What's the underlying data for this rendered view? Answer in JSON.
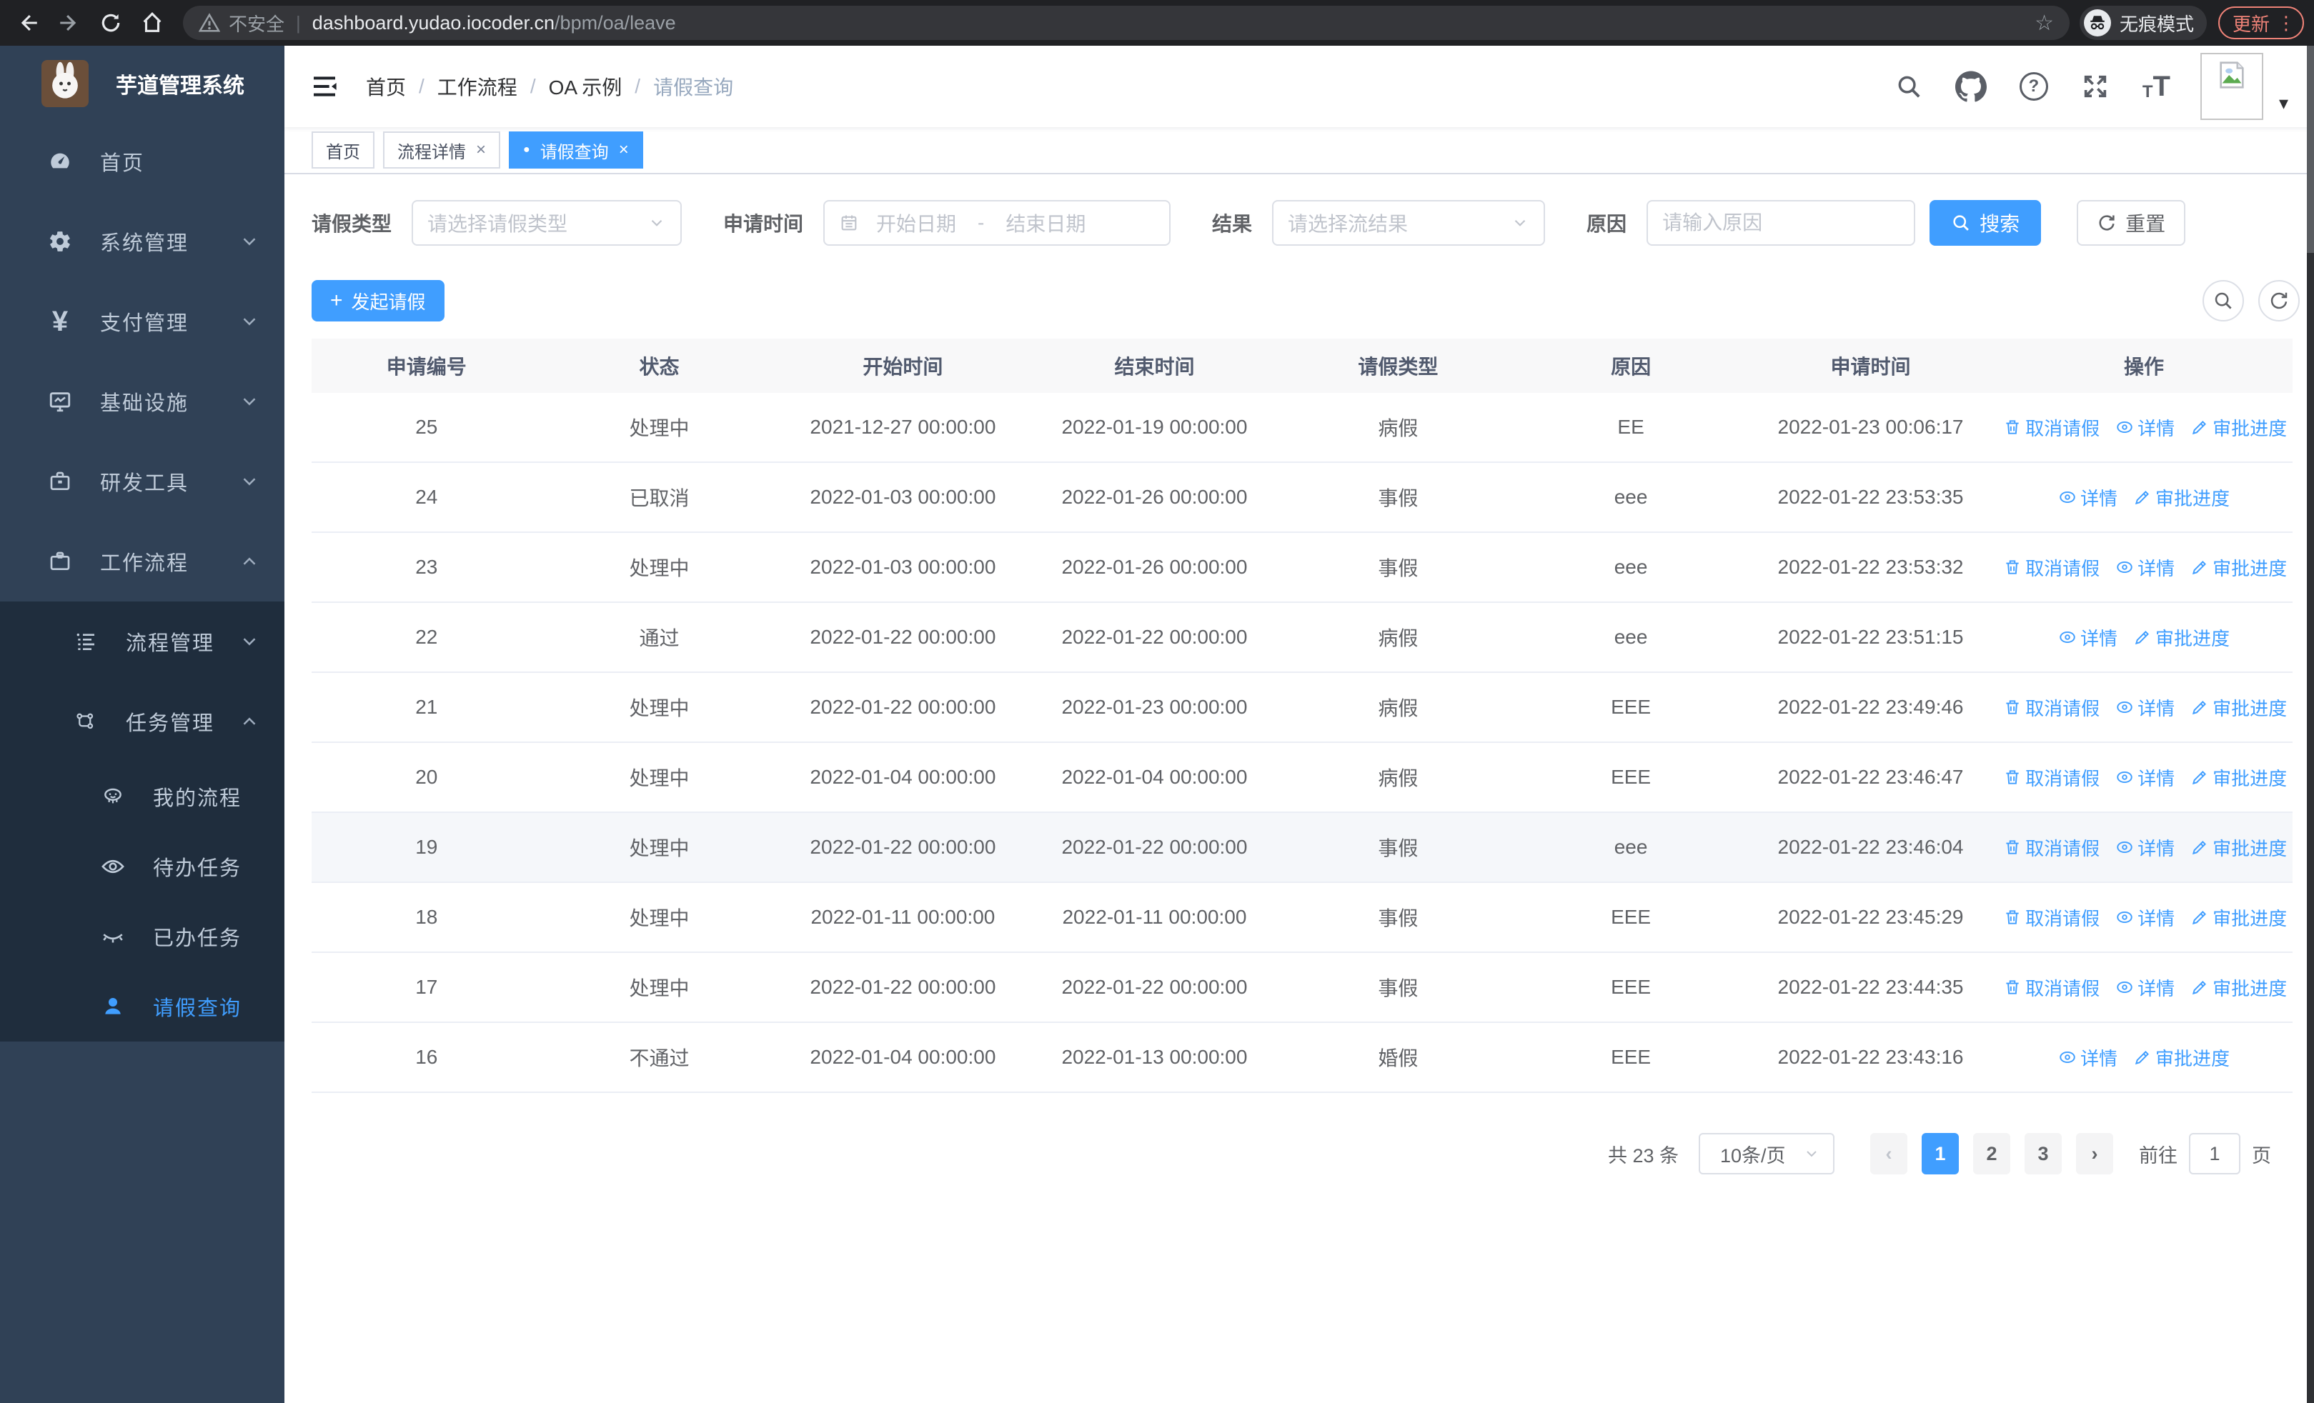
{
  "browser": {
    "security_label": "不安全",
    "url_host": "dashboard.yudao.iocoder.cn",
    "url_path": "/bpm/oa/leave",
    "incognito_label": "无痕模式",
    "update_label": "更新"
  },
  "icons": {
    "star": "☆",
    "menu_dots": "⋮",
    "caret_down": "▾",
    "close": "×",
    "dot": "●",
    "plus": "+",
    "question": "?",
    "url_separator": "|",
    "breadcrumb_separator": "/",
    "range_separator": "-",
    "prev": "‹",
    "next": "›",
    "font_small": "T",
    "font_big": "T"
  },
  "sidebar": {
    "logo_title": "芋道管理系统",
    "items": [
      {
        "label": "首页"
      },
      {
        "label": "系统管理"
      },
      {
        "label": "支付管理"
      },
      {
        "label": "基础设施"
      },
      {
        "label": "研发工具"
      },
      {
        "label": "工作流程"
      }
    ],
    "workflow_children": [
      {
        "label": "流程管理"
      },
      {
        "label": "任务管理"
      }
    ],
    "task_children": [
      {
        "label": "我的流程"
      },
      {
        "label": "待办任务"
      },
      {
        "label": "已办任务"
      },
      {
        "label": "请假查询"
      }
    ]
  },
  "header": {
    "breadcrumb": [
      "首页",
      "工作流程",
      "OA 示例",
      "请假查询"
    ]
  },
  "tabs": {
    "items": [
      {
        "label": "首页"
      },
      {
        "label": "流程详情"
      },
      {
        "label": "请假查询"
      }
    ]
  },
  "filters": {
    "leave_type": {
      "label": "请假类型",
      "placeholder": "请选择请假类型"
    },
    "apply_time": {
      "label": "申请时间",
      "start_placeholder": "开始日期",
      "end_placeholder": "结束日期"
    },
    "result": {
      "label": "结果",
      "placeholder": "请选择流结果"
    },
    "reason": {
      "label": "原因",
      "placeholder": "请输入原因"
    },
    "search_label": "搜索",
    "reset_label": "重置"
  },
  "toolbar": {
    "create_label": "发起请假"
  },
  "table": {
    "columns": [
      "申请编号",
      "状态",
      "开始时间",
      "结束时间",
      "请假类型",
      "原因",
      "申请时间",
      "操作"
    ],
    "action_labels": {
      "cancel": "取消请假",
      "detail": "详情",
      "progress": "审批进度"
    },
    "rows": [
      {
        "id": "25",
        "status": "处理中",
        "start_time": "2021-12-27 00:00:00",
        "end_time": "2022-01-19 00:00:00",
        "leave_type": "病假",
        "reason": "EE",
        "apply_time": "2022-01-23 00:06:17",
        "actions": [
          "cancel",
          "detail",
          "progress"
        ],
        "highlighted": false
      },
      {
        "id": "24",
        "status": "已取消",
        "start_time": "2022-01-03 00:00:00",
        "end_time": "2022-01-26 00:00:00",
        "leave_type": "事假",
        "reason": "eee",
        "apply_time": "2022-01-22 23:53:35",
        "actions": [
          "detail",
          "progress"
        ],
        "highlighted": false
      },
      {
        "id": "23",
        "status": "处理中",
        "start_time": "2022-01-03 00:00:00",
        "end_time": "2022-01-26 00:00:00",
        "leave_type": "事假",
        "reason": "eee",
        "apply_time": "2022-01-22 23:53:32",
        "actions": [
          "cancel",
          "detail",
          "progress"
        ],
        "highlighted": false
      },
      {
        "id": "22",
        "status": "通过",
        "start_time": "2022-01-22 00:00:00",
        "end_time": "2022-01-22 00:00:00",
        "leave_type": "病假",
        "reason": "eee",
        "apply_time": "2022-01-22 23:51:15",
        "actions": [
          "detail",
          "progress"
        ],
        "highlighted": false
      },
      {
        "id": "21",
        "status": "处理中",
        "start_time": "2022-01-22 00:00:00",
        "end_time": "2022-01-23 00:00:00",
        "leave_type": "病假",
        "reason": "EEE",
        "apply_time": "2022-01-22 23:49:46",
        "actions": [
          "cancel",
          "detail",
          "progress"
        ],
        "highlighted": false
      },
      {
        "id": "20",
        "status": "处理中",
        "start_time": "2022-01-04 00:00:00",
        "end_time": "2022-01-04 00:00:00",
        "leave_type": "病假",
        "reason": "EEE",
        "apply_time": "2022-01-22 23:46:47",
        "actions": [
          "cancel",
          "detail",
          "progress"
        ],
        "highlighted": false
      },
      {
        "id": "19",
        "status": "处理中",
        "start_time": "2022-01-22 00:00:00",
        "end_time": "2022-01-22 00:00:00",
        "leave_type": "事假",
        "reason": "eee",
        "apply_time": "2022-01-22 23:46:04",
        "actions": [
          "cancel",
          "detail",
          "progress"
        ],
        "highlighted": true
      },
      {
        "id": "18",
        "status": "处理中",
        "start_time": "2022-01-11 00:00:00",
        "end_time": "2022-01-11 00:00:00",
        "leave_type": "事假",
        "reason": "EEE",
        "apply_time": "2022-01-22 23:45:29",
        "actions": [
          "cancel",
          "detail",
          "progress"
        ],
        "highlighted": false
      },
      {
        "id": "17",
        "status": "处理中",
        "start_time": "2022-01-22 00:00:00",
        "end_time": "2022-01-22 00:00:00",
        "leave_type": "事假",
        "reason": "EEE",
        "apply_time": "2022-01-22 23:44:35",
        "actions": [
          "cancel",
          "detail",
          "progress"
        ],
        "highlighted": false
      },
      {
        "id": "16",
        "status": "不通过",
        "start_time": "2022-01-04 00:00:00",
        "end_time": "2022-01-13 00:00:00",
        "leave_type": "婚假",
        "reason": "EEE",
        "apply_time": "2022-01-22 23:43:16",
        "actions": [
          "detail",
          "progress"
        ],
        "highlighted": false
      }
    ]
  },
  "pagination": {
    "total": "共 23 条",
    "page_size": "10条/页",
    "pages": [
      "1",
      "2",
      "3"
    ],
    "current": "1",
    "goto_label": "前往",
    "goto_value": "1",
    "unit_label": "页"
  }
}
